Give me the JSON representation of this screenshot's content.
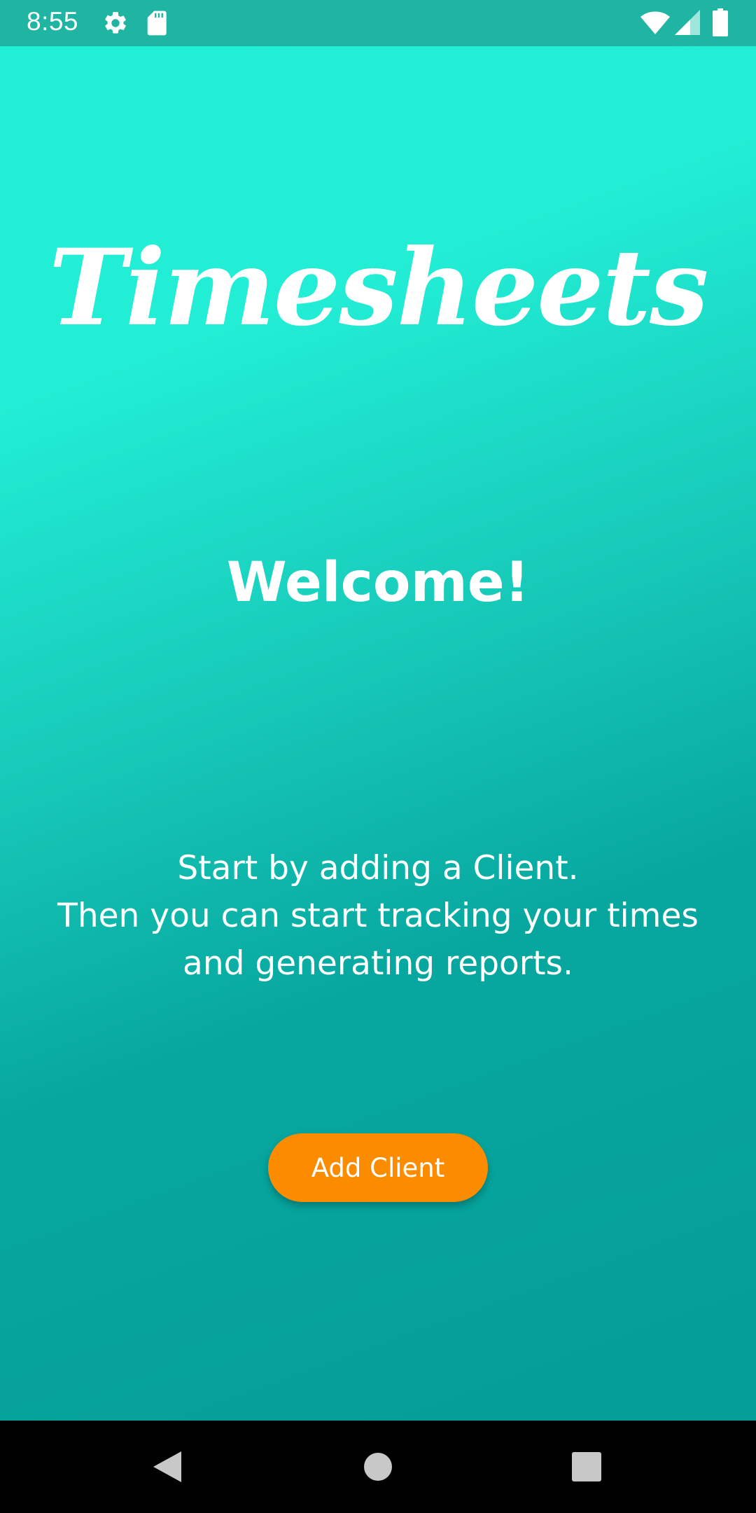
{
  "status_bar": {
    "time": "8:55",
    "icons": [
      "settings-icon",
      "sd-card-icon",
      "wifi-icon",
      "cell-signal-icon",
      "battery-icon"
    ],
    "background": "#1fb5a2"
  },
  "app": {
    "logo_text": "Timesheets",
    "welcome": "Welcome!",
    "intro_lines": [
      "Start by adding a Client.",
      "Then you can start tracking your times",
      "and generating reports."
    ],
    "add_client_label": "Add Client",
    "colors": {
      "gradient_top": "#22f0d6",
      "gradient_bottom": "#049d97",
      "accent": "#fb8c00"
    }
  },
  "nav_bar": {
    "buttons": [
      "back-icon",
      "home-icon",
      "recents-icon"
    ]
  }
}
